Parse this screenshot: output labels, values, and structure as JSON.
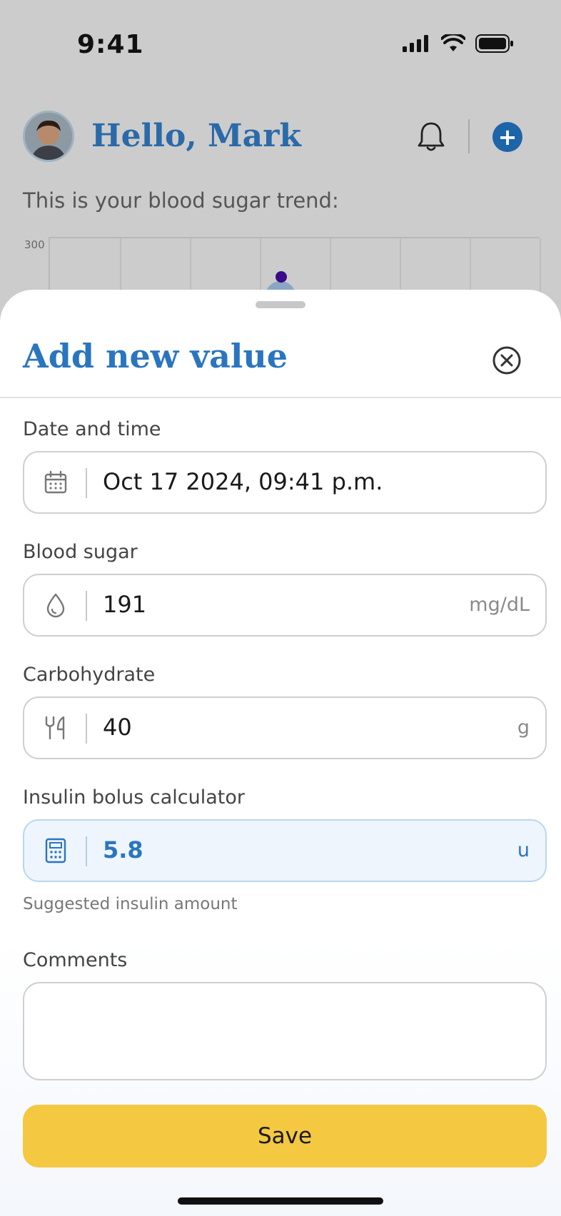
{
  "status_bar": {
    "time": "9:41"
  },
  "header": {
    "greeting": "Hello, Mark"
  },
  "trend": {
    "label": "This is your blood sugar trend:",
    "y_top_label": "300"
  },
  "sheet": {
    "title": "Add new value",
    "fields": {
      "date": {
        "label": "Date and time",
        "value": "Oct 17 2024, 09:41 p.m.",
        "icon": "calendar-icon"
      },
      "blood_sugar": {
        "label": "Blood sugar",
        "value": "191",
        "unit": "mg/dL",
        "icon": "drop-icon"
      },
      "carbohydrate": {
        "label": "Carbohydrate",
        "value": "40",
        "unit": "g",
        "icon": "fork-knife-icon"
      },
      "insulin": {
        "label": "Insulin bolus calculator",
        "value": "5.8",
        "unit": "u",
        "icon": "calculator-icon",
        "helper": "Suggested insulin amount"
      },
      "comments": {
        "label": "Comments",
        "value": ""
      }
    },
    "save_label": "Save"
  },
  "colors": {
    "accent_blue": "#2a75bf",
    "save_yellow": "#f5c842",
    "plus_blue": "#1e64a8"
  }
}
